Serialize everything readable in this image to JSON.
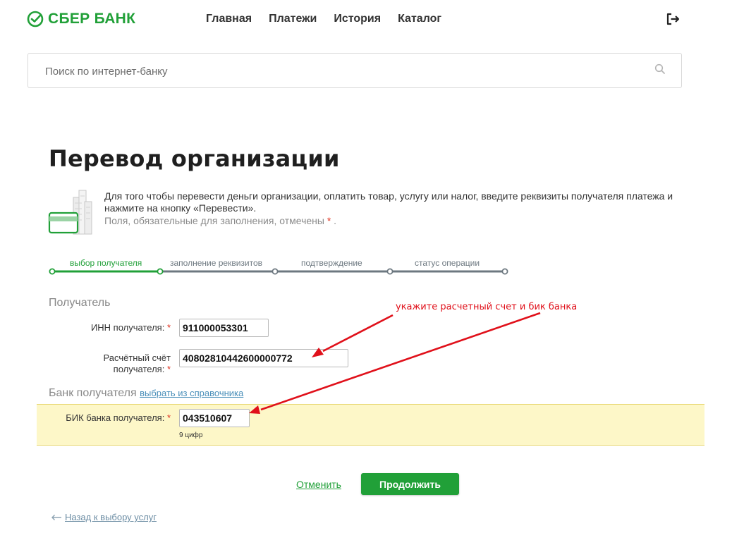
{
  "brand": {
    "name": "СБЕР БАНК",
    "color": "#21a038"
  },
  "nav": [
    "Главная",
    "Платежи",
    "История",
    "Каталог"
  ],
  "icons": {
    "logout": "logout-icon",
    "search": "search-icon",
    "logo": "sber-logo-icon",
    "illustration": "card-building-icon",
    "back": "arrow-left-icon"
  },
  "search": {
    "placeholder": "Поиск по интернет-банку",
    "value": ""
  },
  "page": {
    "title": "Перевод организации",
    "info": "Для того чтобы перевести деньги организации, оплатить товар, услугу или налог, введите реквизиты получателя платежа и нажмите на кнопку «Перевести».",
    "required_note": "Поля, обязательные для заполнения, отмечены",
    "required_mark": "*",
    "required_end": "."
  },
  "steps": [
    {
      "label": "выбор получателя",
      "active": true
    },
    {
      "label": "заполнение реквизитов",
      "active": false
    },
    {
      "label": "подтверждение",
      "active": false
    },
    {
      "label": "статус операции",
      "active": false
    }
  ],
  "form": {
    "recipient_section": "Получатель",
    "inn_label": "ИНН получателя:",
    "inn_value": "911000053301",
    "account_label_line1": "Расчётный счёт",
    "account_label_line2": "получателя:",
    "account_value": "40802810442600000772",
    "bank_section": "Банк получателя",
    "bank_link": "выбрать из справочника",
    "bik_label": "БИК банка получателя:",
    "bik_value": "043510607",
    "bik_hint": "9 цифр",
    "required_mark": "*"
  },
  "annotation": {
    "text": "укажите расчетный счет и бик банка",
    "color": "#e0101a"
  },
  "actions": {
    "cancel": "Отменить",
    "continue": "Продолжить",
    "back": "Назад к выбору услуг"
  },
  "colors": {
    "accent": "#21a038",
    "highlight": "#fdf7c8",
    "link": "#4a8fb9",
    "step_inactive": "#6d7880"
  }
}
